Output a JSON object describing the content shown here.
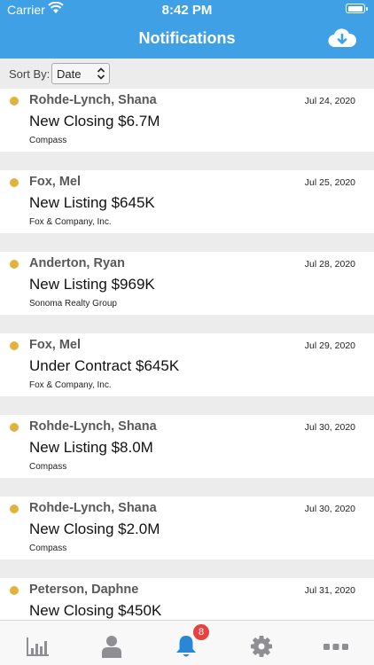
{
  "status_bar": {
    "carrier": "Carrier",
    "time": "8:42 PM"
  },
  "header": {
    "title": "Notifications",
    "action_icon": "cloud-download-icon"
  },
  "sort": {
    "label": "Sort By:",
    "selected": "Date"
  },
  "notifications": [
    {
      "name": "Rohde-Lynch, Shana",
      "date": "Jul 24, 2020",
      "headline": "New Closing $6.7M",
      "company": "Compass"
    },
    {
      "name": "Fox, Mel",
      "date": "Jul 25, 2020",
      "headline": "New Listing $645K",
      "company": "Fox & Company, Inc."
    },
    {
      "name": "Anderton, Ryan",
      "date": "Jul 28, 2020",
      "headline": "New Listing $969K",
      "company": "Sonoma Realty Group"
    },
    {
      "name": "Fox, Mel",
      "date": "Jul 29, 2020",
      "headline": "Under Contract $645K",
      "company": "Fox & Company, Inc."
    },
    {
      "name": "Rohde-Lynch, Shana",
      "date": "Jul 30, 2020",
      "headline": "New Listing $8.0M",
      "company": "Compass"
    },
    {
      "name": "Rohde-Lynch, Shana",
      "date": "Jul 30, 2020",
      "headline": "New Closing $2.0M",
      "company": "Compass"
    },
    {
      "name": "Peterson, Daphne",
      "date": "Jul 31, 2020",
      "headline": "New Closing $450K",
      "company": ""
    }
  ],
  "tabs": [
    {
      "icon": "chart-icon"
    },
    {
      "icon": "person-icon"
    },
    {
      "icon": "bell-icon",
      "badge": "8",
      "active": true
    },
    {
      "icon": "gear-icon"
    },
    {
      "icon": "more-icon"
    }
  ],
  "colors": {
    "brand": "#3fa0e6",
    "dot": "#e2b33b",
    "badge": "#e54343",
    "inactive_tab": "#8e8e93"
  }
}
